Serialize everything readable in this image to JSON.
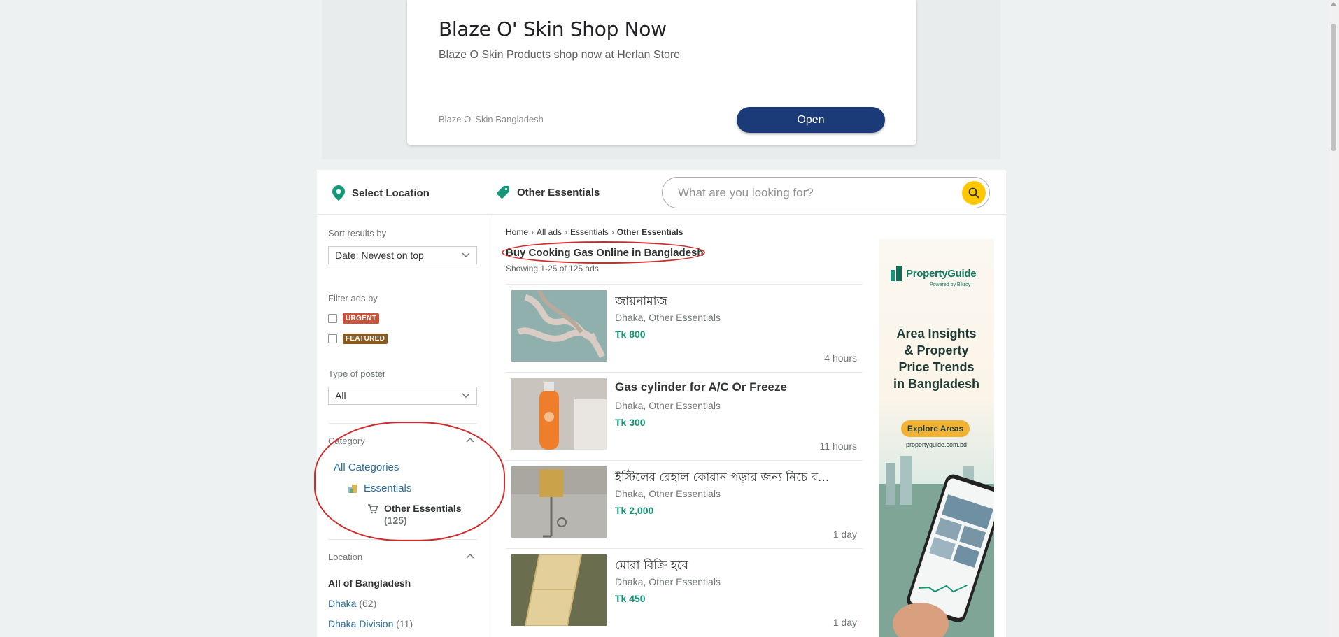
{
  "ad": {
    "title": "Blaze O' Skin Shop Now",
    "description": "Blaze O Skin Products shop now at Herlan Store",
    "brand": "Blaze O' Skin Bangladesh",
    "button": "Open"
  },
  "topbar": {
    "location_label": "Select Location",
    "category_label": "Other Essentials",
    "search_placeholder": "What are you looking for?"
  },
  "sidebar": {
    "sort_label": "Sort results by",
    "sort_value": "Date: Newest on top",
    "filter_label": "Filter ads by",
    "filters": [
      "URGENT",
      "FEATURED"
    ],
    "poster_label": "Type of poster",
    "poster_value": "All",
    "category_heading": "Category",
    "all_categories": "All Categories",
    "parent_category": "Essentials",
    "current_category": "Other Essentials",
    "current_count": "(125)",
    "location_heading": "Location",
    "all_location": "All of Bangladesh",
    "locations": [
      {
        "name": "Dhaka",
        "count": "(62)"
      },
      {
        "name": "Dhaka Division",
        "count": "(11)"
      }
    ]
  },
  "breadcrumb": [
    "Home",
    "All ads",
    "Essentials",
    "Other Essentials"
  ],
  "page_title": "Buy Cooking Gas Online in Bangladesh",
  "showing": "Showing 1-25 of 125 ads",
  "listings": [
    {
      "title": "জায়নামাজ",
      "location": "Dhaka, Other Essentials",
      "price": "Tk 800",
      "time": "4 hours"
    },
    {
      "title": "Gas cylinder for A/C Or Freeze",
      "location": "Dhaka, Other Essentials",
      "price": "Tk 300",
      "time": "11 hours"
    },
    {
      "title": "ইস্টিলের রেহাল কোরান পড়ার জন্য নিচে ব...",
      "location": "Dhaka, Other Essentials",
      "price": "Tk 2,000",
      "time": "1 day"
    },
    {
      "title": "মোরা বিক্রি হবে",
      "location": "Dhaka, Other Essentials",
      "price": "Tk 450",
      "time": "1 day"
    }
  ],
  "side_ad": {
    "brand": "PropertyGuide",
    "powered": "Powered by  Bikroy",
    "headline": [
      "Area Insights",
      "& Property",
      "Price Trends",
      "in Bangladesh"
    ],
    "cta": "Explore Areas",
    "url": "propertyguide.com.bd"
  },
  "colors": {
    "brand_green": "#149777",
    "search_yellow": "#ffc800",
    "ad_button": "#1b3b78",
    "annotation_red": "#d12a2a"
  }
}
